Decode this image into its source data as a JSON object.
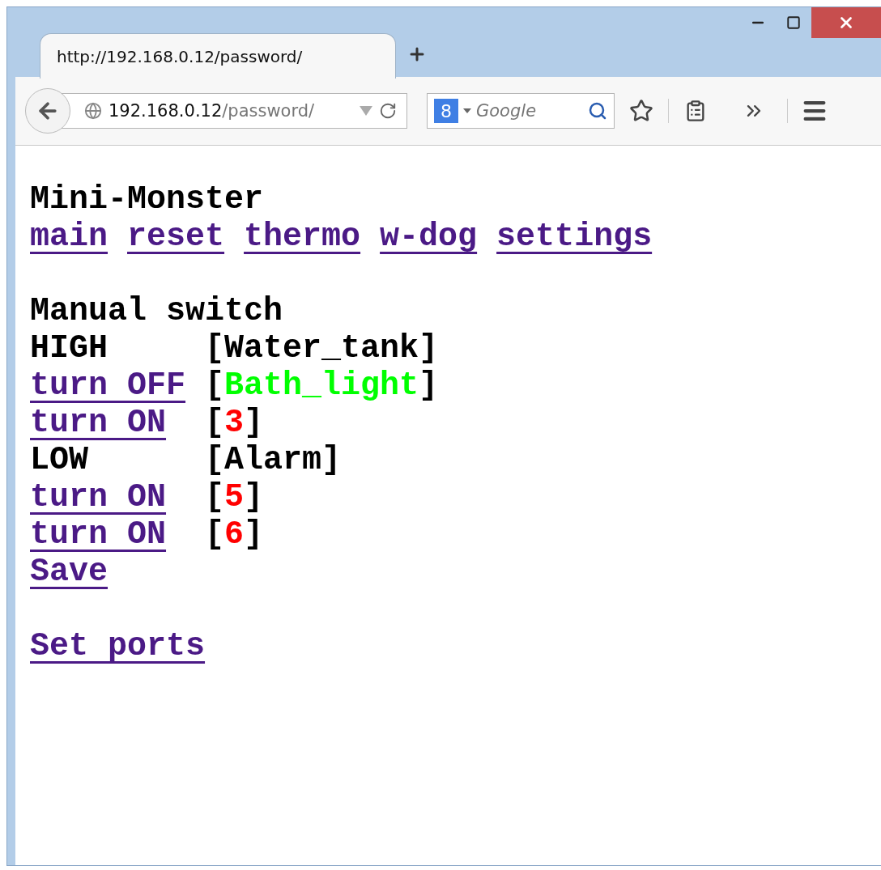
{
  "window": {
    "tab_title": "http://192.168.0.12/password/"
  },
  "address_bar": {
    "host": "192.168.0.12",
    "path": "/password/"
  },
  "search": {
    "engine_mark": "8",
    "placeholder": "Google"
  },
  "page": {
    "title": "Mini-Monster",
    "nav": [
      "main",
      "reset",
      "thermo",
      "w-dog",
      "settings"
    ],
    "section": "Manual switch",
    "rows": [
      {
        "kind": "state",
        "action": "HIGH",
        "open": "[",
        "name": "Water_tank",
        "close": "]",
        "color": "#000000"
      },
      {
        "kind": "link",
        "action": "turn OFF",
        "open": "[",
        "name": "Bath_light",
        "close": "]",
        "color": "#00ff00"
      },
      {
        "kind": "link",
        "action": "turn ON",
        "open": "[",
        "name": "3",
        "close": "]",
        "color": "#ff0000"
      },
      {
        "kind": "state",
        "action": "LOW",
        "open": "[",
        "name": "Alarm",
        "close": "]",
        "color": "#000000"
      },
      {
        "kind": "link",
        "action": "turn ON",
        "open": "[",
        "name": "5",
        "close": "]",
        "color": "#ff0000"
      },
      {
        "kind": "link",
        "action": "turn ON",
        "open": "[",
        "name": "6",
        "close": "]",
        "color": "#ff0000"
      }
    ],
    "save": "Save",
    "set_ports": "Set ports"
  }
}
